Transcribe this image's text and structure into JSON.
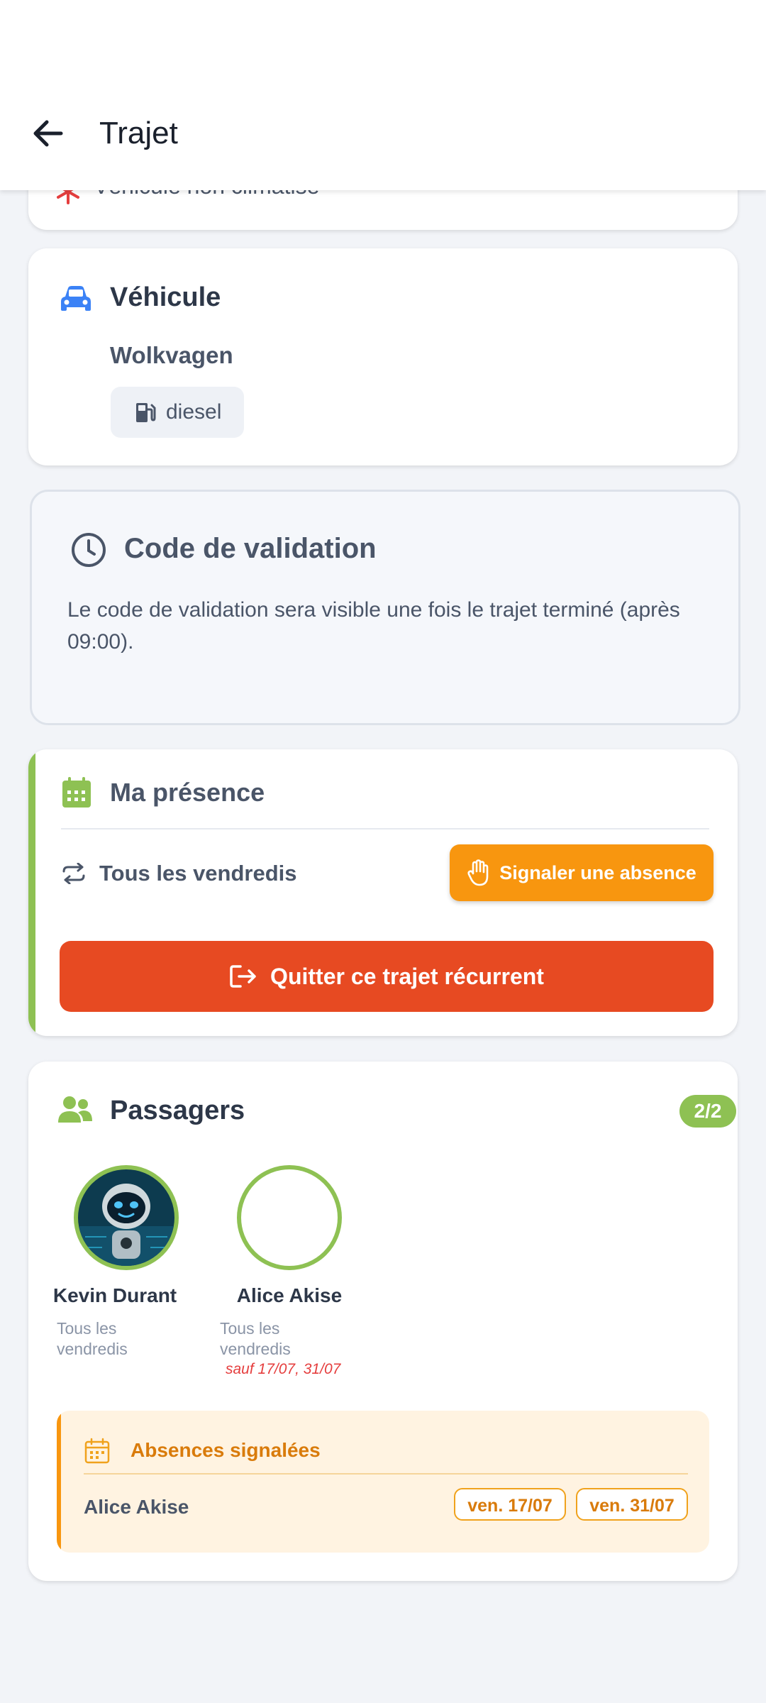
{
  "header": {
    "title": "Trajet"
  },
  "clipped_card": {
    "text": "Véhicule non climatisé"
  },
  "vehicle": {
    "title": "Véhicule",
    "model": "Wolkvagen",
    "fuel": "diesel",
    "icon": "car-icon",
    "accent": "#3b82f6"
  },
  "validation": {
    "title": "Code de validation",
    "message": "Le code de validation sera visible une fois le trajet terminé (après 09:00)."
  },
  "presence": {
    "title": "Ma présence",
    "schedule": "Tous les vendredis",
    "report_absence_label": "Signaler une absence",
    "leave_label": "Quitter ce trajet récurrent",
    "accent": "#8ec153"
  },
  "passengers": {
    "title": "Passagers",
    "count": "2/2",
    "items": [
      {
        "name": "Kevin Durant",
        "schedule_line1": "Tous les",
        "schedule_line2": "vendredis",
        "exception": ""
      },
      {
        "name": "Alice Akise",
        "schedule_line1": "Tous les",
        "schedule_line2": "vendredis",
        "exception": "sauf 17/07, 31/07"
      }
    ]
  },
  "absences": {
    "title": "Absences signalées",
    "rows": [
      {
        "name": "Alice Akise",
        "dates": [
          "ven. 17/07",
          "ven. 31/07"
        ]
      }
    ]
  }
}
